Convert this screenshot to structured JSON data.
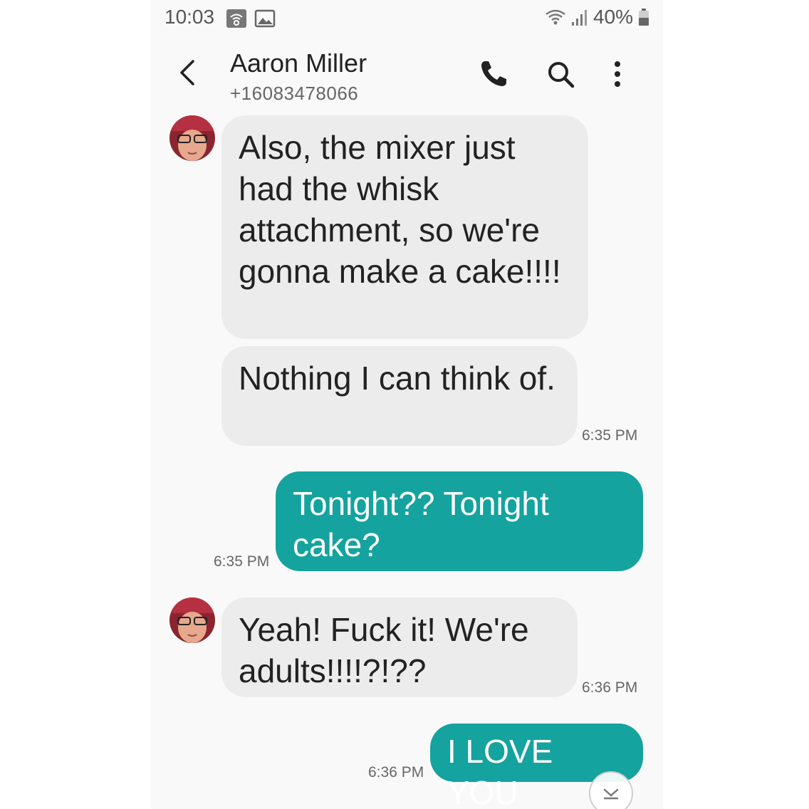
{
  "status_bar": {
    "time": "10:03",
    "battery": "40%",
    "icons": [
      "wifi-calling-icon",
      "image-notification-icon",
      "wifi-icon",
      "signal-icon",
      "battery-icon"
    ]
  },
  "header": {
    "contact_name": "Aaron Miller",
    "contact_number": "+16083478066",
    "icons": [
      "back-arrow-icon",
      "phone-icon",
      "search-icon",
      "more-vert-icon"
    ]
  },
  "messages": [
    {
      "direction": "incoming",
      "text": "Also, the mixer just had the whisk attachment, so we're gonna make a cake!!!!",
      "time": ""
    },
    {
      "direction": "incoming",
      "text": "Nothing I can think of.",
      "time": "6:35 PM"
    },
    {
      "direction": "outgoing",
      "text": "Tonight?? Tonight cake?",
      "time": "6:35 PM"
    },
    {
      "direction": "incoming",
      "text": "Yeah! Fuck it! We're adults!!!!?!??",
      "time": "6:36 PM"
    },
    {
      "direction": "outgoing",
      "text": "I LOVE YOU",
      "time": "6:36 PM"
    }
  ],
  "colors": {
    "outgoing_bubble": "#14a39e",
    "incoming_bubble": "#ececec",
    "background": "#f9f9f9"
  },
  "scroll_button_icon": "chevron-down-icon"
}
